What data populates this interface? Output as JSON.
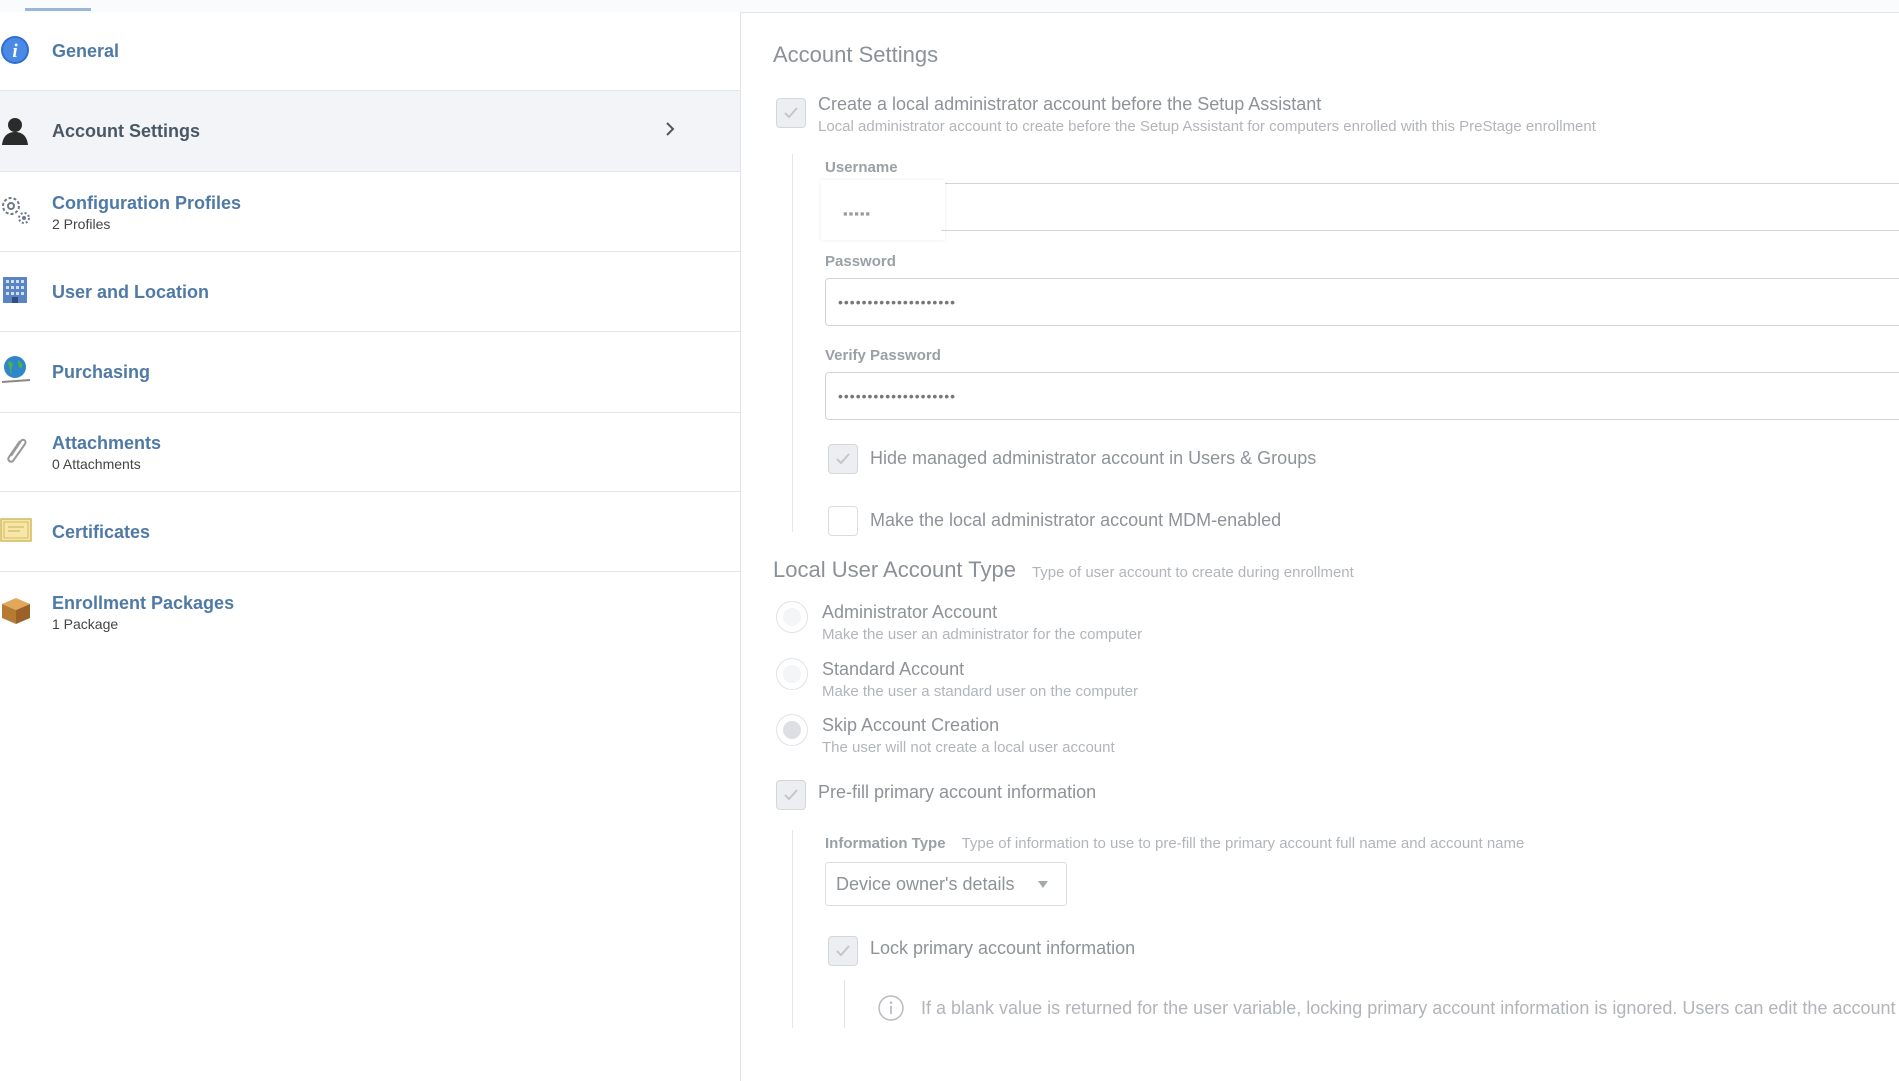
{
  "sidebar": {
    "items": [
      {
        "label": "General",
        "sub": ""
      },
      {
        "label": "Account Settings",
        "sub": ""
      },
      {
        "label": "Configuration Profiles",
        "sub": "2 Profiles"
      },
      {
        "label": "User and Location",
        "sub": ""
      },
      {
        "label": "Purchasing",
        "sub": ""
      },
      {
        "label": "Attachments",
        "sub": "0 Attachments"
      },
      {
        "label": "Certificates",
        "sub": ""
      },
      {
        "label": "Enrollment Packages",
        "sub": "1 Package"
      }
    ],
    "active_index": 1
  },
  "main": {
    "title": "Account Settings",
    "create_admin": {
      "label": "Create a local administrator account before the Setup Assistant",
      "desc": "Local administrator account to create before the Setup Assistant for computers enrolled with this PreStage enrollment",
      "checked": true
    },
    "username": {
      "label": "Username",
      "value": "▪▪▪▪▪"
    },
    "password": {
      "label": "Password",
      "value": "••••••••••••••••••••"
    },
    "verify_password": {
      "label": "Verify Password",
      "value": "••••••••••••••••••••"
    },
    "hide_admin": {
      "label": "Hide managed administrator account in Users & Groups",
      "checked": true
    },
    "mdm_enabled": {
      "label": "Make the local administrator account MDM-enabled",
      "checked": false
    },
    "local_user_type": {
      "title": "Local User Account Type",
      "desc": "Type of user account to create during enrollment",
      "options": [
        {
          "label": "Administrator Account",
          "desc": "Make the user an administrator for the computer"
        },
        {
          "label": "Standard Account",
          "desc": "Make the user a standard user on the computer"
        },
        {
          "label": "Skip Account Creation",
          "desc": "The user will not create a local user account"
        }
      ],
      "selected_index": 2
    },
    "prefill": {
      "label": "Pre-fill primary account information",
      "checked": true
    },
    "info_type": {
      "label": "Information Type",
      "desc": "Type of information to use to pre-fill the primary account full name and account name",
      "value": "Device owner's details"
    },
    "lock_info": {
      "label": "Lock primary account information",
      "checked": true
    },
    "note": "If a blank value is returned for the user variable, locking primary account information is ignored. Users can edit the account"
  },
  "colors": {
    "link": "#4f7aa6",
    "active_bg": "#f2f4f7",
    "muted_text": "#8e9399"
  }
}
